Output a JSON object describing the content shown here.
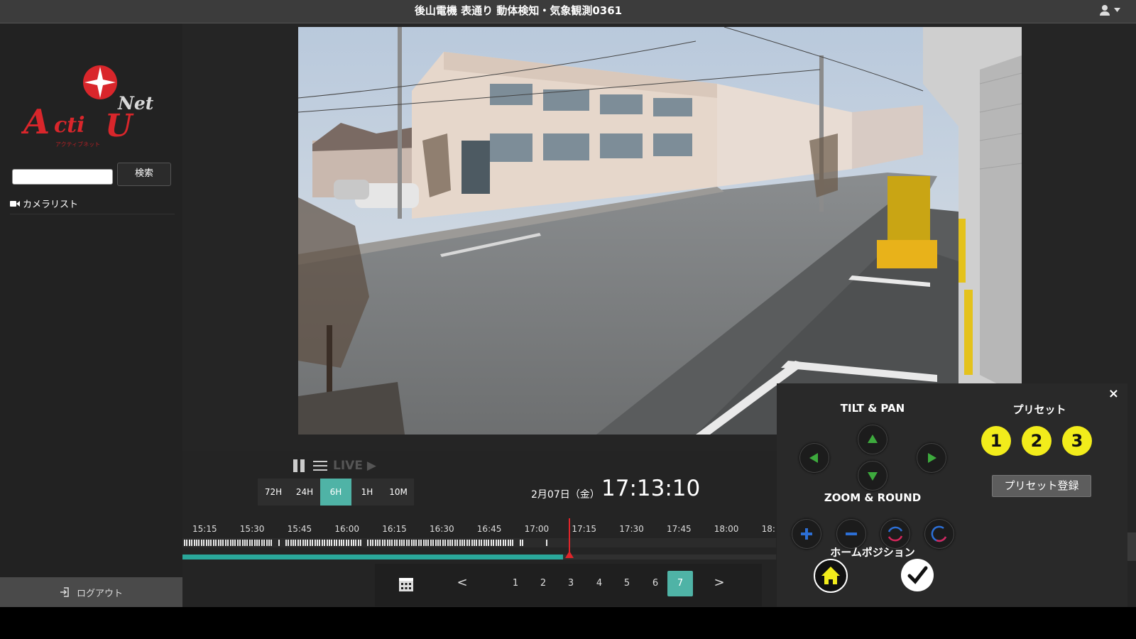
{
  "header": {
    "title": "後山電機 表通り 動体検知・気象観測0361"
  },
  "sidebar": {
    "logo": {
      "main": "Activ",
      "sub": "Net",
      "kana": "アクティブネット"
    },
    "search": {
      "placeholder": "",
      "value": "",
      "button_label": "検索"
    },
    "camera_list_label": "カメラリスト",
    "logout_label": "ログアウト"
  },
  "playback": {
    "live_label": "LIVE",
    "ranges": [
      "72H",
      "24H",
      "6H",
      "1H",
      "10M"
    ],
    "active_range": "6H",
    "date": "2月07日（金）",
    "time": "17:13:10"
  },
  "timeline": {
    "ticks": [
      "15:15",
      "15:30",
      "15:45",
      "16:00",
      "16:15",
      "16:30",
      "16:45",
      "17:00",
      "17:15",
      "17:30",
      "17:45",
      "18:00",
      "18:"
    ]
  },
  "pager": {
    "prev": "<",
    "next": ">",
    "pages": [
      "1",
      "2",
      "3",
      "4",
      "5",
      "6",
      "7"
    ],
    "active_page": "7"
  },
  "ptz": {
    "tilt_pan_label": "TILT & PAN",
    "zoom_round_label": "ZOOM & ROUND",
    "home_position_label": "ホームポジション",
    "preset_label": "プリセット",
    "presets": [
      "1",
      "2",
      "3"
    ],
    "preset_register_label": "プリセット登録",
    "close_label": "×"
  },
  "colors": {
    "accent": "#4fb3a6",
    "playhead": "#e0252a",
    "preset": "#f2ec1b",
    "arrow_green": "#3daa3d"
  }
}
